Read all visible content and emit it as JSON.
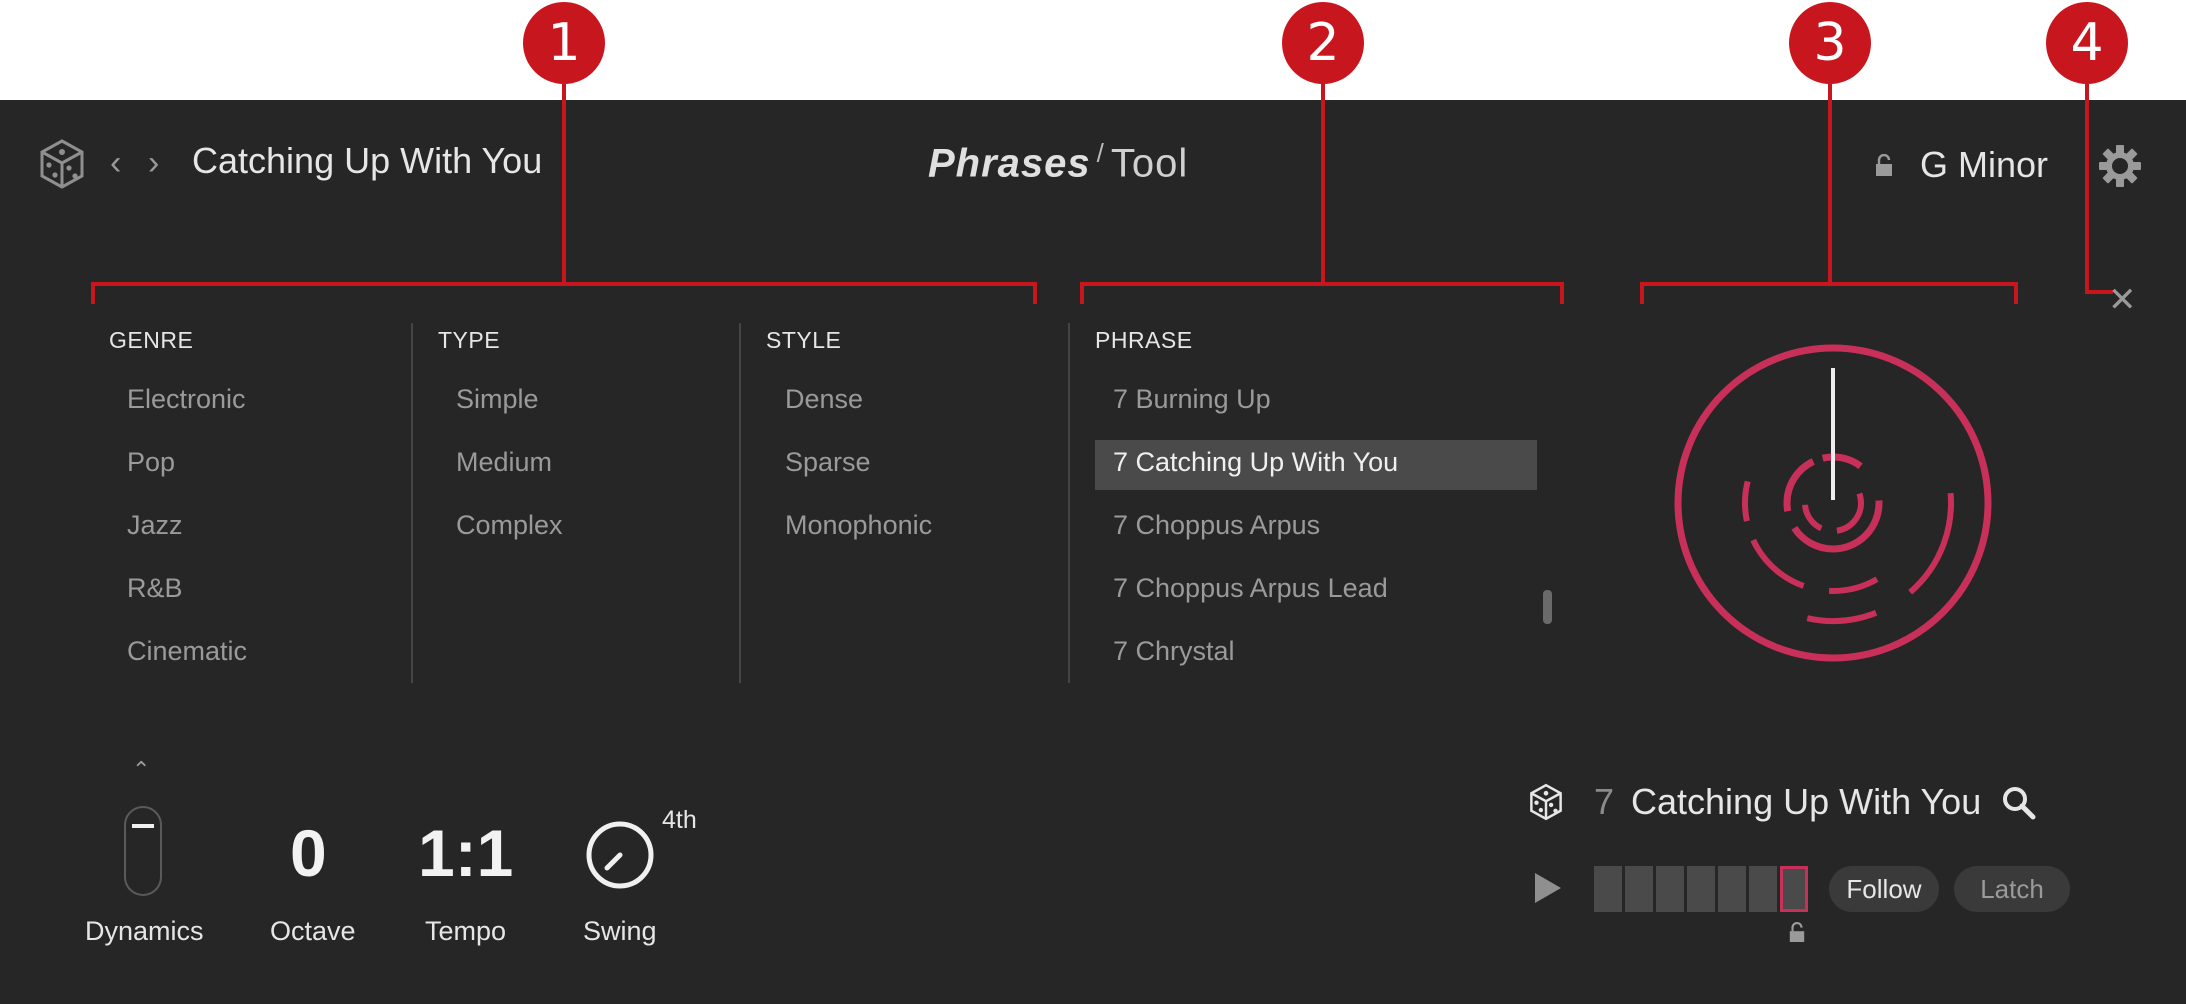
{
  "callouts": [
    "1",
    "2",
    "3",
    "4"
  ],
  "header": {
    "title": "Catching Up With You",
    "logo_main": "Phrases",
    "logo_slash": "/",
    "logo_sub": "Tool",
    "key": "G Minor"
  },
  "genre": {
    "header": "GENRE",
    "items": [
      "Electronic",
      "Pop",
      "Jazz",
      "R&B",
      "Cinematic"
    ]
  },
  "type": {
    "header": "TYPE",
    "items": [
      "Simple",
      "Medium",
      "Complex"
    ]
  },
  "style": {
    "header": "STYLE",
    "items": [
      "Dense",
      "Sparse",
      "Monophonic"
    ]
  },
  "phrase": {
    "header": "PHRASE",
    "items": [
      "7 Burning Up",
      "7 Catching Up With You",
      "7 Choppus Arpus",
      "7 Choppus Arpus Lead",
      "7 Chrystal"
    ],
    "selected_index": 1
  },
  "controls": {
    "dynamics_label": "Dynamics",
    "octave_value": "0",
    "octave_label": "Octave",
    "tempo_value": "1:1",
    "tempo_label": "Tempo",
    "swing_label": "Swing",
    "swing_value": "4th"
  },
  "player": {
    "number": "7",
    "name": "Catching Up With You",
    "follow_label": "Follow",
    "latch_label": "Latch",
    "steps_total": 7,
    "active_step": 7
  },
  "colors": {
    "accent": "#c8305a",
    "callout": "#c8161e",
    "background": "#262626"
  },
  "icons": [
    "dice-icon",
    "chevron-left-icon",
    "chevron-right-icon",
    "lock-icon",
    "gear-icon",
    "close-icon",
    "chevron-up-icon",
    "play-icon",
    "search-icon"
  ]
}
